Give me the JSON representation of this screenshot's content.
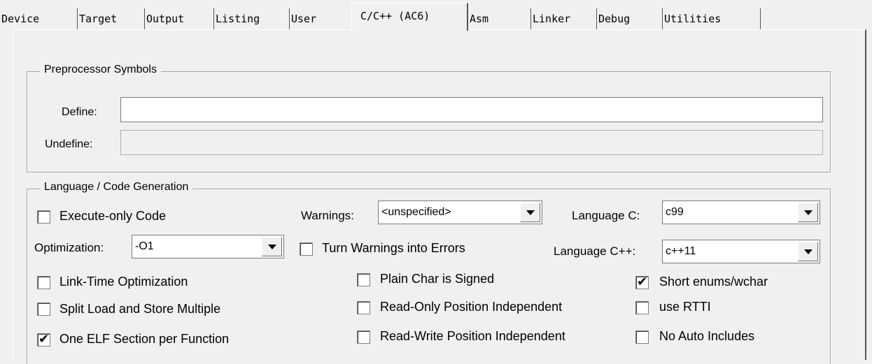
{
  "tabs": [
    {
      "label": "Device",
      "active": false
    },
    {
      "label": "Target",
      "active": false
    },
    {
      "label": "Output",
      "active": false
    },
    {
      "label": "Listing",
      "active": false
    },
    {
      "label": "User",
      "active": false
    },
    {
      "label": "C/C++ (AC6)",
      "active": true
    },
    {
      "label": "Asm",
      "active": false
    },
    {
      "label": "Linker",
      "active": false
    },
    {
      "label": "Debug",
      "active": false
    },
    {
      "label": "Utilities",
      "active": false
    }
  ],
  "preprocessor": {
    "legend": "Preprocessor Symbols",
    "define_label": "Define:",
    "define_value": "",
    "undefine_label": "Undefine:",
    "undefine_value": ""
  },
  "language": {
    "legend": "Language / Code Generation",
    "execute_only": {
      "label": "Execute-only Code",
      "checked": false
    },
    "warnings": {
      "label": "Warnings:",
      "value": "<unspecified>"
    },
    "language_c": {
      "label": "Language C:",
      "value": "c99"
    },
    "optimization": {
      "label": "Optimization:",
      "value": "-O1"
    },
    "warnings_as_errors": {
      "label": "Turn Warnings into Errors",
      "checked": false
    },
    "language_cpp": {
      "label": "Language C++:",
      "value": "c++11"
    },
    "link_time_opt": {
      "label": "Link-Time Optimization",
      "checked": false
    },
    "plain_char_signed": {
      "label": "Plain Char is Signed",
      "checked": false
    },
    "short_enums": {
      "label": "Short enums/wchar",
      "checked": true
    },
    "split_load_store": {
      "label": "Split Load and Store Multiple",
      "checked": false
    },
    "ro_pi": {
      "label": "Read-Only Position Independent",
      "checked": false
    },
    "use_rtti": {
      "label": "use RTTI",
      "checked": false
    },
    "one_elf_section": {
      "label": "One ELF Section per Function",
      "checked": true
    },
    "rw_pi": {
      "label": "Read-Write Position Independent",
      "checked": false
    },
    "no_auto_includes": {
      "label": "No Auto Includes",
      "checked": false
    }
  },
  "checkmark_glyph": "✔"
}
